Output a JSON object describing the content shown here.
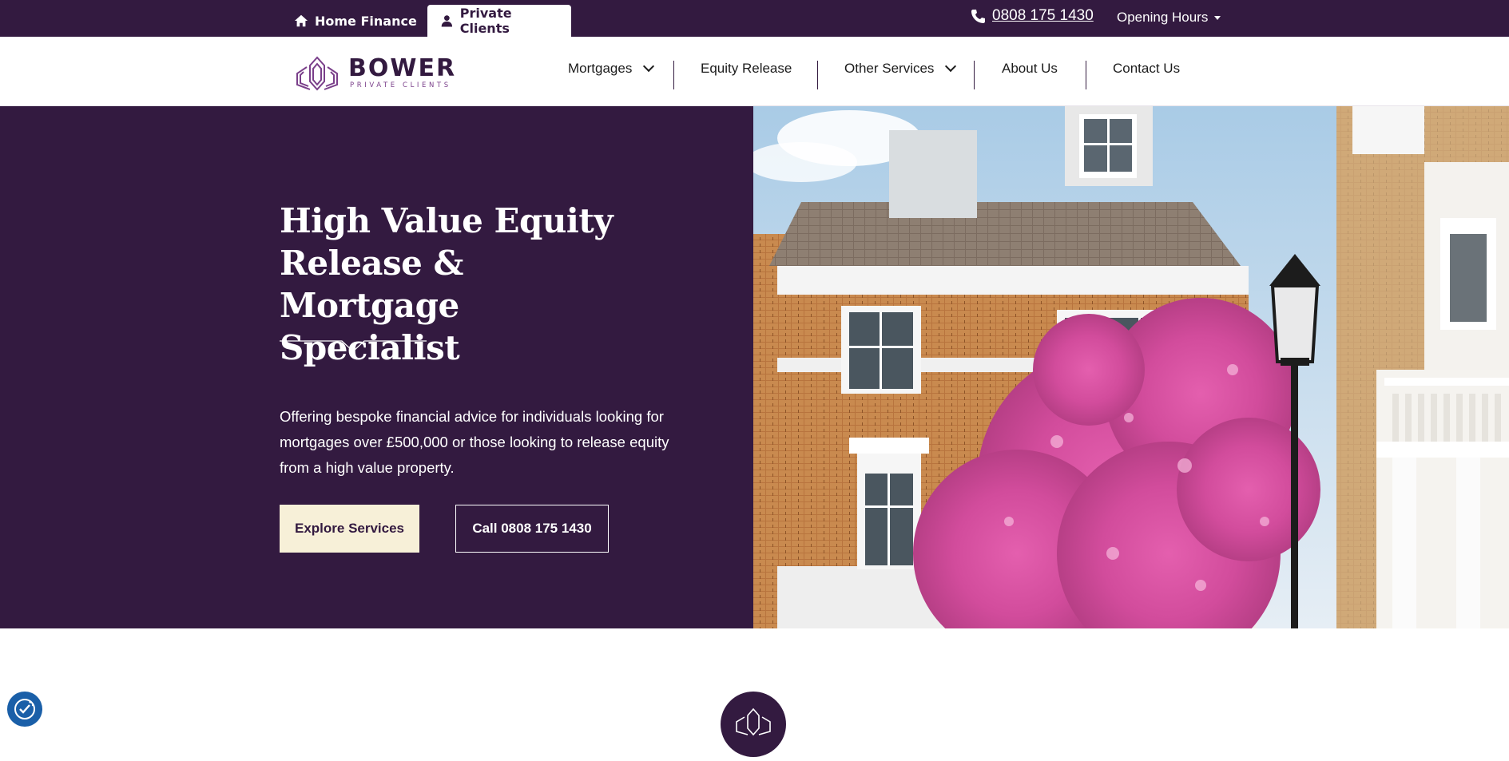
{
  "topbar": {
    "tabs": [
      {
        "label": "Home Finance",
        "icon": "home-icon"
      },
      {
        "label": "Private Clients",
        "icon": "person-icon"
      }
    ],
    "phone": "0808 175 1430",
    "opening_hours": "Opening Hours"
  },
  "nav": {
    "logo_main": "BOWER",
    "logo_sub": "PRIVATE CLIENTS",
    "items": [
      {
        "label": "Mortgages",
        "dropdown": true
      },
      {
        "label": "Equity Release",
        "dropdown": false
      },
      {
        "label": "Other Services",
        "dropdown": true
      },
      {
        "label": "About Us",
        "dropdown": false
      },
      {
        "label": "Contact Us",
        "dropdown": false
      }
    ]
  },
  "hero": {
    "title": "High Value Equity Release & Mortgage Specialist",
    "intro": "Offering bespoke financial advice for individuals looking for mortgages over £500,000 or those looking to release equity from a high value property.",
    "buttons": {
      "explore": "Explore Services",
      "call": "Call 0808 175 1430"
    },
    "image_alt": "London townhouse with pink magnolia tree"
  },
  "colors": {
    "brand": "#331a40",
    "accent": "#7a3f8a",
    "cream": "#f7f0d8",
    "cookie": "#1a5fa8"
  }
}
